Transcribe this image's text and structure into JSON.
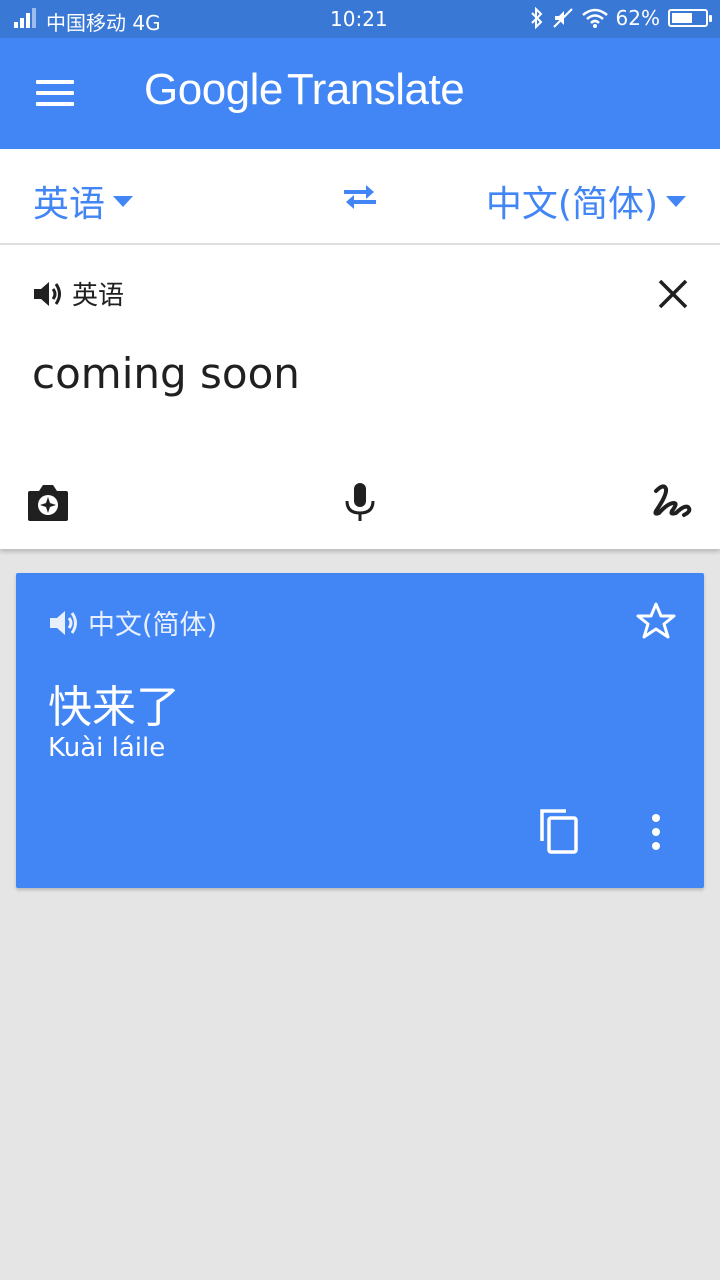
{
  "status_bar": {
    "carrier": "中国移动 4G",
    "time": "10:21",
    "battery_percent": "62%",
    "battery_level": 0.62,
    "icons": [
      "signal-icon",
      "bluetooth-icon",
      "mute-icon",
      "wifi-icon",
      "battery-icon"
    ]
  },
  "app_bar": {
    "title_google": "Google",
    "title_translate": "Translate"
  },
  "language_bar": {
    "source_language": "英语",
    "target_language": "中文(简体)",
    "accent_color": "#4285f4"
  },
  "input": {
    "language_label": "英语",
    "text": "coming soon"
  },
  "result": {
    "language_label": "中文(简体)",
    "translation": "快来了",
    "romanization": "Kuài láile",
    "card_color": "#4285f4"
  }
}
